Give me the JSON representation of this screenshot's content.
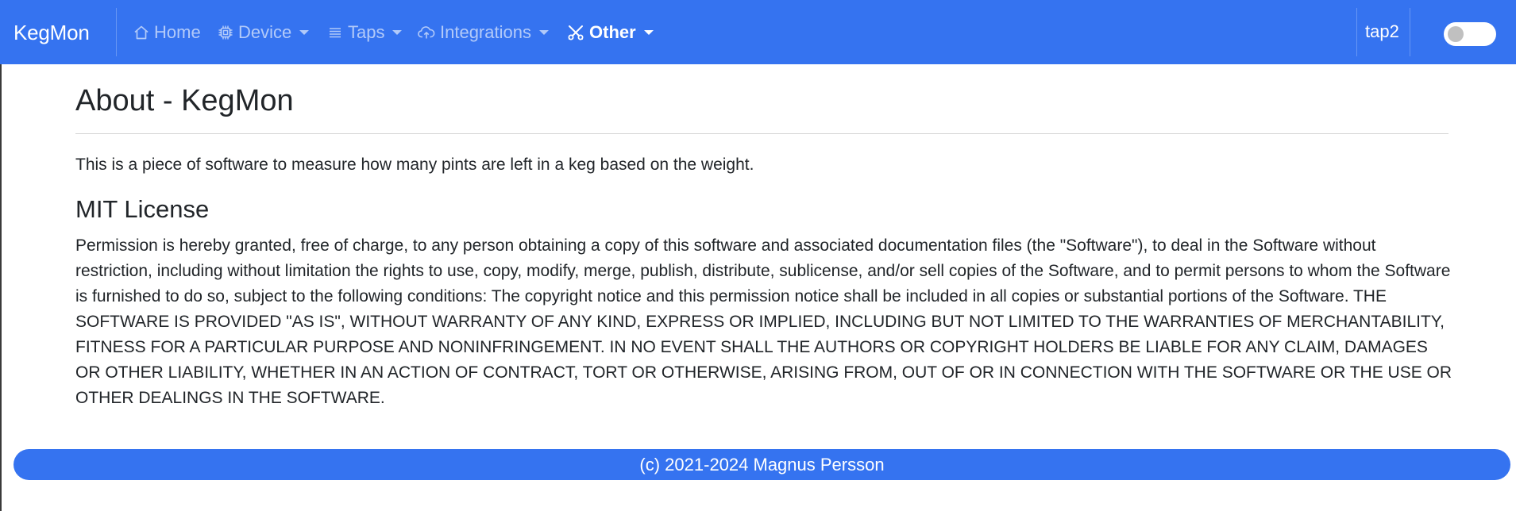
{
  "app": {
    "brand": "KegMon"
  },
  "nav": {
    "items": [
      {
        "label": "Home",
        "icon": "home-icon",
        "dropdown": false,
        "active": false
      },
      {
        "label": "Device",
        "icon": "chip-icon",
        "dropdown": true,
        "active": false
      },
      {
        "label": "Taps",
        "icon": "list-icon",
        "dropdown": true,
        "active": false
      },
      {
        "label": "Integrations",
        "icon": "cloud-upload-icon",
        "dropdown": true,
        "active": false
      },
      {
        "label": "Other",
        "icon": "tools-icon",
        "dropdown": true,
        "active": true
      }
    ],
    "device_name": "tap2",
    "theme_toggle_on": false
  },
  "colors": {
    "accent": "#3573f0",
    "text": "#212529"
  },
  "main": {
    "title": "About - KegMon",
    "intro": "This is a piece of software to measure how many pints are left in a keg based on the weight.",
    "license_heading": "MIT License",
    "license_text": "Permission is hereby granted, free of charge, to any person obtaining a copy of this software and associated documentation files (the \"Software\"), to deal in the Software without restriction, including without limitation the rights to use, copy, modify, merge, publish, distribute, sublicense, and/or sell copies of the Software, and to permit persons to whom the Software is furnished to do so, subject to the following conditions: The copyright notice and this permission notice shall be included in all copies or substantial portions of the Software. THE SOFTWARE IS PROVIDED \"AS IS\", WITHOUT WARRANTY OF ANY KIND, EXPRESS OR IMPLIED, INCLUDING BUT NOT LIMITED TO THE WARRANTIES OF MERCHANTABILITY, FITNESS FOR A PARTICULAR PURPOSE AND NONINFRINGEMENT. IN NO EVENT SHALL THE AUTHORS OR COPYRIGHT HOLDERS BE LIABLE FOR ANY CLAIM, DAMAGES OR OTHER LIABILITY, WHETHER IN AN ACTION OF CONTRACT, TORT OR OTHERWISE, ARISING FROM, OUT OF OR IN CONNECTION WITH THE SOFTWARE OR THE USE OR OTHER DEALINGS IN THE SOFTWARE."
  },
  "footer": {
    "text": "(c) 2021-2024 Magnus Persson"
  }
}
